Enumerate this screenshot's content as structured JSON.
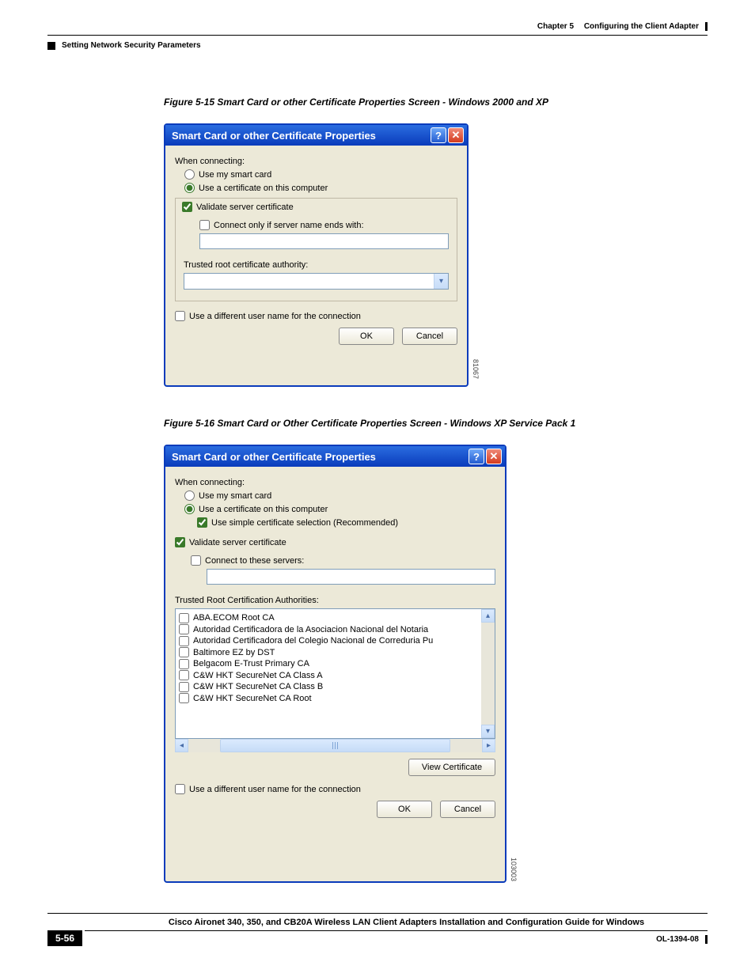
{
  "header": {
    "chapter": "Chapter 5",
    "title": "Configuring the Client Adapter"
  },
  "section": "Setting Network Security Parameters",
  "captions": {
    "c1": "Figure 5-15   Smart Card or other Certificate Properties Screen - Windows 2000 and XP",
    "c2": "Figure 5-16   Smart Card or Other Certificate Properties Screen - Windows XP Service Pack 1"
  },
  "dlg1": {
    "title": "Smart Card or other Certificate Properties",
    "when": "When connecting:",
    "r1": "Use my smart card",
    "r2": "Use a certificate on this computer",
    "validate": "Validate server certificate",
    "connect": "Connect only if server name ends with:",
    "trusted": "Trusted root certificate authority:",
    "diffuser": "Use a different user name for the connection",
    "ok": "OK",
    "cancel": "Cancel",
    "sidenum": "81067"
  },
  "dlg2": {
    "title": "Smart Card or other Certificate Properties",
    "when": "When connecting:",
    "r1": "Use my smart card",
    "r2": "Use a certificate on this computer",
    "simple": "Use simple certificate selection (Recommended)",
    "validate": "Validate server certificate",
    "connect": "Connect to these servers:",
    "trusted": "Trusted Root Certification Authorities:",
    "items": [
      "ABA.ECOM Root CA",
      "Autoridad Certificadora de la Asociacion Nacional del Notaria",
      "Autoridad Certificadora del Colegio Nacional de Correduria Pu",
      "Baltimore EZ by DST",
      "Belgacom E-Trust Primary CA",
      "C&W HKT SecureNet CA Class A",
      "C&W HKT SecureNet CA Class B",
      "C&W HKT SecureNet CA Root"
    ],
    "view": "View Certificate",
    "diffuser": "Use a different user name for the connection",
    "ok": "OK",
    "cancel": "Cancel",
    "sidenum": "103003"
  },
  "footer": {
    "title": "Cisco Aironet 340, 350, and CB20A Wireless LAN Client Adapters Installation and Configuration Guide for Windows",
    "page": "5-56",
    "ol": "OL-1394-08"
  }
}
